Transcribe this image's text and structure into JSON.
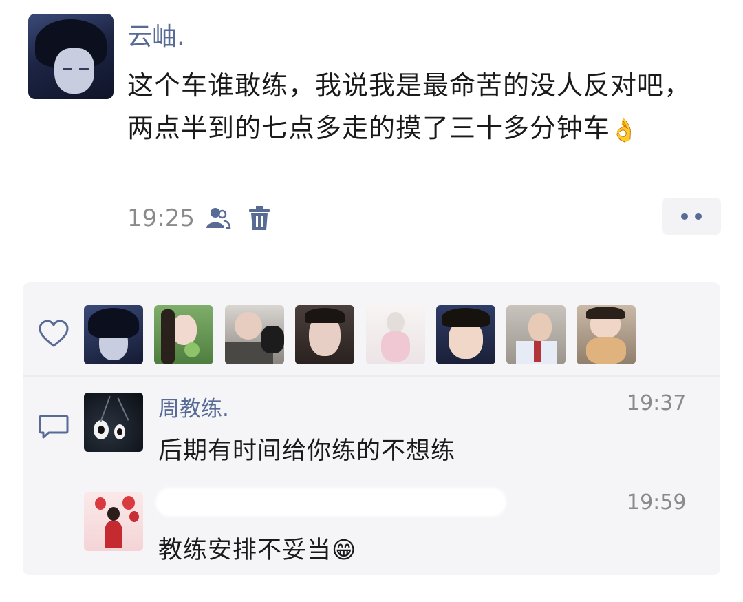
{
  "post": {
    "author": "云岫.",
    "text": "这个车谁敢练，我说我是最命苦的没人反对吧，两点半到的七点多走的摸了三十多分钟车",
    "emoji": "👌",
    "time": "19:25",
    "icons": [
      "friends-visibility-icon",
      "trash-icon",
      "more-icon"
    ]
  },
  "likes": {
    "icon": "heart-icon",
    "count_avatars": 8,
    "avatars": [
      "liker-1",
      "liker-2",
      "liker-3",
      "liker-4",
      "liker-5",
      "liker-6",
      "liker-7",
      "liker-8"
    ]
  },
  "comments": [
    {
      "name": "周教练.",
      "time": "19:37",
      "text": "后期有时间给你练的不想练"
    },
    {
      "name": "",
      "time": "19:59",
      "text": "教练安排不妥当",
      "emoji": "😁"
    }
  ],
  "colors": {
    "link": "#576b95",
    "muted": "#8a8a8a",
    "panel": "#f5f5f7"
  }
}
